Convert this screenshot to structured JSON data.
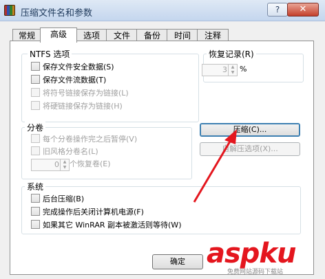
{
  "window": {
    "title": "压缩文件名和参数",
    "help_label": "?",
    "close_label": "✕"
  },
  "tabs": [
    {
      "label": "常规"
    },
    {
      "label": "高级"
    },
    {
      "label": "选项"
    },
    {
      "label": "文件"
    },
    {
      "label": "备份"
    },
    {
      "label": "时间"
    },
    {
      "label": "注释"
    }
  ],
  "ntfs": {
    "legend": "NTFS 选项",
    "items": [
      {
        "label": "保存文件安全数据(S)"
      },
      {
        "label": "保存文件流数据(T)"
      },
      {
        "label": "将符号链接保存为链接(L)"
      },
      {
        "label": "将硬链接保存为链接(H)"
      }
    ]
  },
  "recovery": {
    "legend": "恢复记录(R)",
    "value": "3",
    "unit": "%"
  },
  "volume": {
    "legend": "分卷",
    "items": [
      {
        "label": "每个分卷操作完之后暂停(V)"
      },
      {
        "label": "旧风格分卷名(L)"
      }
    ],
    "spin_value": "0",
    "spin_label": "个恢复卷(E)"
  },
  "buttons": {
    "compress": "压缩(C)...",
    "self_extract": "自解压选项(X)..."
  },
  "system": {
    "legend": "系统",
    "items": [
      {
        "label": "后台压缩(B)"
      },
      {
        "label": "完成操作后关闭计算机电源(F)"
      },
      {
        "label": "如果其它 WinRAR 副本被激活则等待(W)"
      }
    ]
  },
  "footer": {
    "ok": "确定"
  },
  "watermark": {
    "text": "aspku",
    "sub": "免费网站源码下载站"
  },
  "colors": {
    "annotation_arrow": "#e4161e",
    "focus": "#3c7fb1"
  }
}
